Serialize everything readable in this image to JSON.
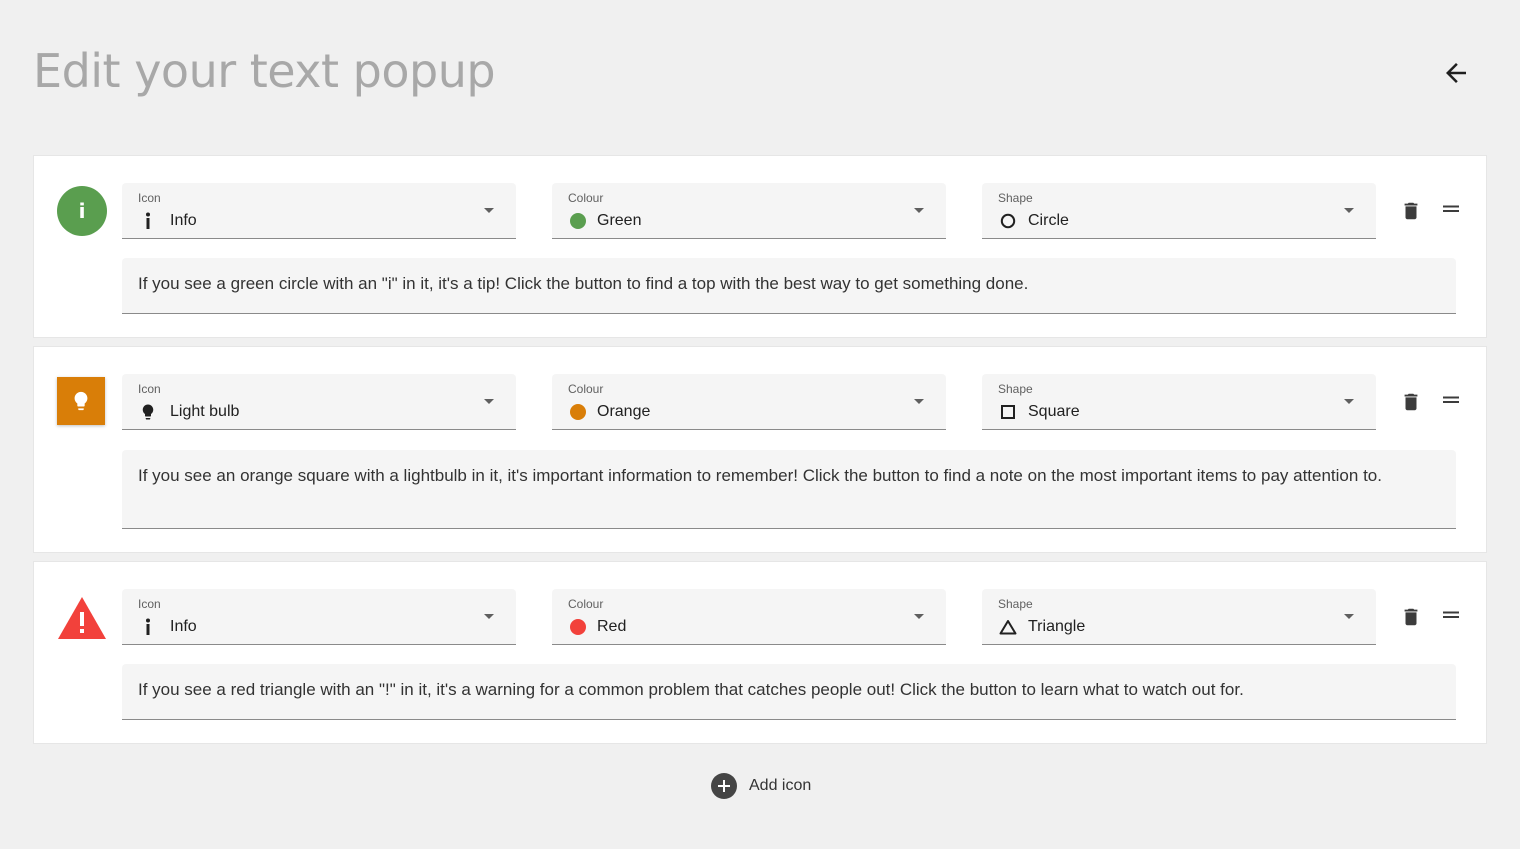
{
  "page": {
    "title": "Edit your text popup"
  },
  "labels": {
    "icon": "Icon",
    "colour": "Colour",
    "shape": "Shape"
  },
  "items": [
    {
      "icon": "Info",
      "icon_name": "info-icon",
      "colour": "Green",
      "colour_hex": "#5a9e4f",
      "shape": "Circle",
      "badge_glyph": "i",
      "text": "If you see a green circle with an \"i\" in it, it's a tip! Click the button to find a top with the best way to get something done."
    },
    {
      "icon": "Light bulb",
      "icon_name": "lightbulb-icon",
      "colour": "Orange",
      "colour_hex": "#d97e08",
      "shape": "Square",
      "text": "If you see an orange square with a lightbulb in it, it's important information to remember! Click the button to find a note on the most important items to pay attention to."
    },
    {
      "icon": "Info",
      "icon_name": "info-icon",
      "colour": "Red",
      "colour_hex": "#f2413b",
      "shape": "Triangle",
      "badge_glyph": "!",
      "text": "If you see a red triangle with an \"!\" in it, it's a warning for a common problem that catches people out! Click the button to learn what to watch out for."
    }
  ],
  "footer": {
    "add_label": "Add icon"
  }
}
